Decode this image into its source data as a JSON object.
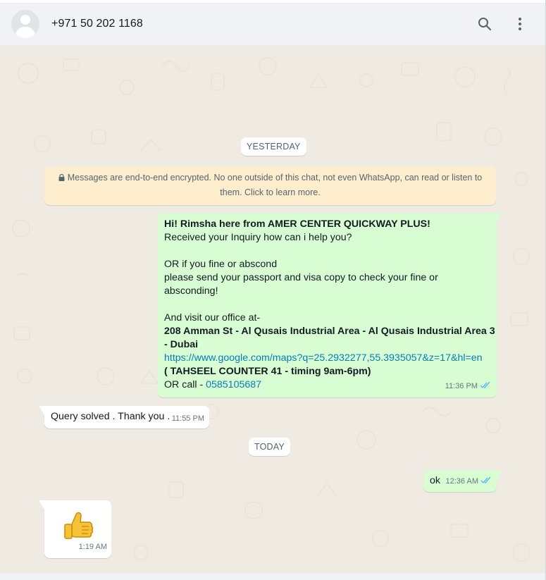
{
  "header": {
    "contact_name": "+971 50 202 1168",
    "icons": [
      "person-avatar-icon",
      "search-icon",
      "kebab-menu-icon"
    ]
  },
  "chat": {
    "date_yesterday": "YESTERDAY",
    "encryption_notice": {
      "line1": "Messages are end-to-end encrypted. No one outside of this chat, not even WhatsApp, can read or listen to",
      "line2": "them. Click to learn more."
    },
    "messages": [
      {
        "direction": "outgoing",
        "lines": {
          "l1": "Hi! Rimsha here from AMER CENTER QUICKWAY PLUS!",
          "l2": "Received your Inquiry how can i help you?",
          "l3": "OR if you fine or abscond",
          "l4": "please send your passport and visa copy to check your fine or",
          "l5": "absconding!",
          "l6": "And visit our office at-",
          "l7": "208 Amman St - Al Qusais Industrial Area - Al Qusais Industrial Area 3",
          "l8": "- Dubai",
          "l9": "https://www.google.com/maps?q=25.2932277,55.3935057&z=17&hl=en",
          "l10": "( TAHSEEL COUNTER 41 - timing 9am-6pm)",
          "l11_prefix": "OR call - ",
          "l11_phone": "0585105687"
        },
        "time": "11:36 PM",
        "status": "read"
      },
      {
        "direction": "incoming",
        "text": "Query solved . Thank you .",
        "time": "11:55 PM"
      }
    ],
    "date_today": "TODAY",
    "messages_today": [
      {
        "direction": "outgoing",
        "text": "ok",
        "time": "12:36 AM",
        "status": "read"
      },
      {
        "direction": "incoming",
        "emoji": "👍",
        "emoji_name": "thumbs-up",
        "time": "1:19 AM"
      }
    ]
  },
  "colors": {
    "header_bg": "#f0f2f5",
    "chat_bg": "#efeae2",
    "outgoing_bubble": "#d9fdd3",
    "incoming_bubble": "#ffffff",
    "notice_bg": "#ffeecd",
    "link": "#027eb5",
    "read_ticks": "#53bdeb"
  }
}
